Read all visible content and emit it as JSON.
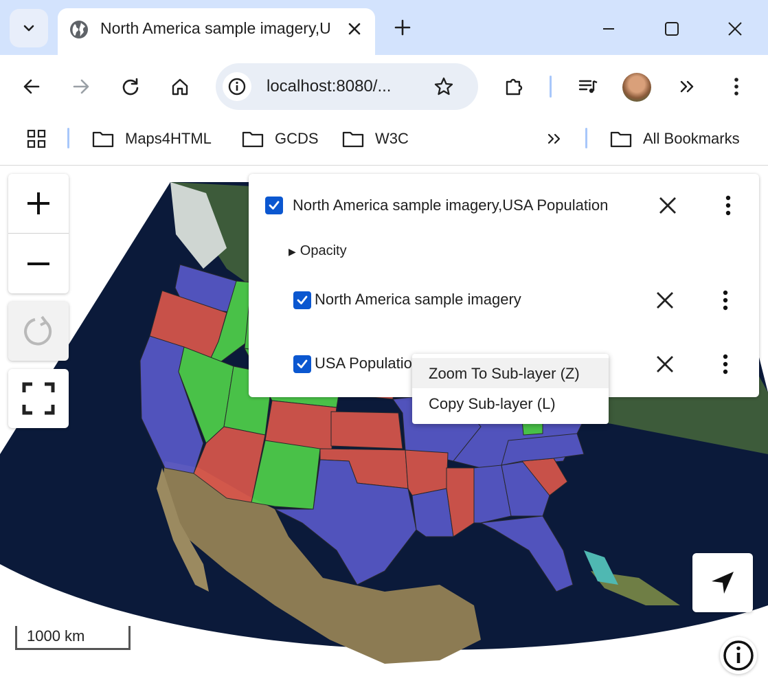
{
  "browser": {
    "tab_title": "North America sample imagery,USA Population",
    "url": "localhost:8080/...",
    "window_controls": [
      "minimize-icon",
      "maximize-icon",
      "close-icon"
    ],
    "bookmarks": [
      "Maps4HTML",
      "GCDS",
      "W3C"
    ],
    "all_bookmarks_label": "All Bookmarks"
  },
  "colors": {
    "tab_strip": "#d3e3fd",
    "checkbox": "#0b57d0",
    "population_red": "#d9564b",
    "population_green": "#4fd04a",
    "population_blue": "#5858c8",
    "ocean": "#0b1a3a"
  },
  "layer_panel": {
    "layer_label": "North America sample imagery,USA Population",
    "layer_checked": true,
    "opacity_label": "Opacity",
    "sublayers": [
      {
        "label": "North America sample imagery",
        "checked": true
      },
      {
        "label": "USA Population",
        "checked": true
      }
    ]
  },
  "context_menu": {
    "items": [
      {
        "label": "Zoom To Sub-layer (Z)"
      },
      {
        "label": "Copy Sub-layer (L)"
      }
    ]
  },
  "map": {
    "scale_label": "1000 km"
  }
}
